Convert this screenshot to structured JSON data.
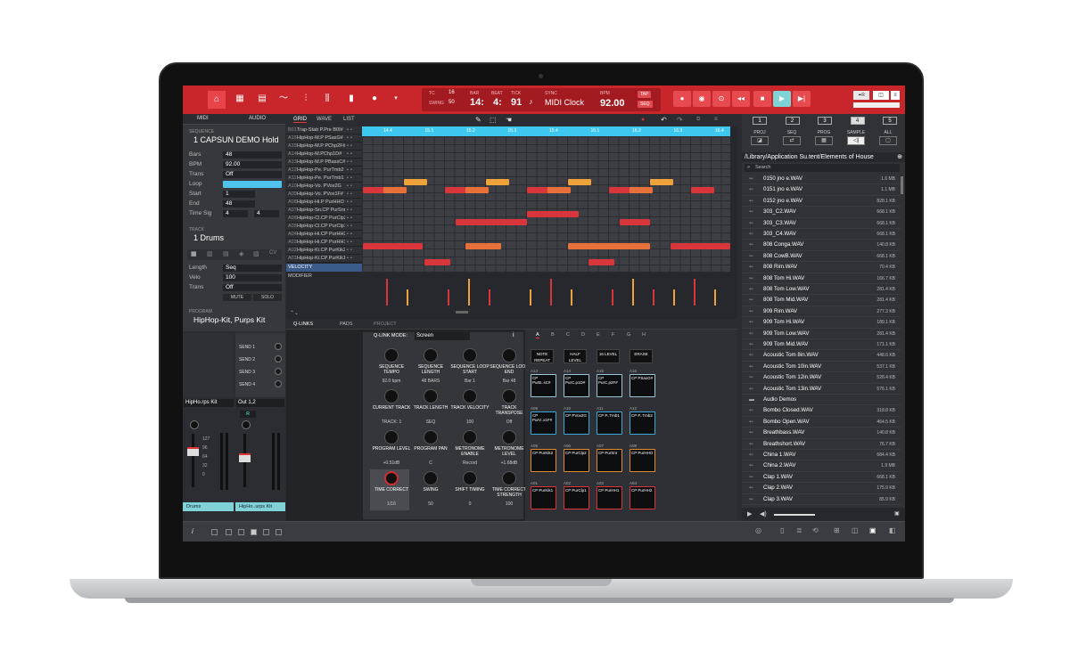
{
  "topbar": {
    "transport": {
      "tc_label": "TC",
      "tc_value": "16",
      "swing_label": "SWING",
      "swing_value": "50",
      "bar_label": "BAR",
      "bar_value": "14:",
      "beat_label": "BEAT",
      "beat_value": "4:",
      "tick_label": "TICK",
      "tick_value": "91",
      "sync_label": "SYNC",
      "sync_value": "MIDI Clock",
      "bpm_label": "BPM",
      "bpm_value": "92.00",
      "tap_label": "TAP",
      "seq_label": "SEQ"
    }
  },
  "left": {
    "tab_midi": "MIDI",
    "tab_audio": "AUDIO",
    "sequence_label": "SEQUENCE",
    "sequence_name": "1 CAPSUN DEMO Hold",
    "fields": {
      "bars_label": "Bars",
      "bars": "48",
      "bpm_label": "BPM",
      "bpm": "92.00",
      "trans_label": "Trans",
      "trans": "Off",
      "loop_label": "Loop",
      "start_label": "Start",
      "start": "1",
      "end_label": "End",
      "end": "48",
      "timesig_label": "Time Sig",
      "ts_num": "4",
      "ts_den": "4"
    },
    "track_label": "TRACK",
    "track_name": "1 Drums",
    "track_fields": {
      "length_label": "Length",
      "length": "Seq",
      "velo_label": "Velo",
      "velo": "100",
      "trans_label": "Trans",
      "trans": "Off",
      "mute": "MUTE",
      "solo": "SOLO",
      "cv": "CV"
    },
    "program_label": "PROGRAM",
    "program_name": "HipHop-Kit, Purps Kit",
    "mixer": {
      "sends": [
        "SEND 1",
        "SEND 2",
        "SEND 3",
        "SEND 4"
      ],
      "input": "HipHo.rps Kit",
      "output": "Out 1,2",
      "rec": "R",
      "ch1": "Drums",
      "ch2": "HipHo..urps Kit",
      "scale": [
        "127",
        "96",
        "64",
        "32",
        "0"
      ]
    }
  },
  "grid": {
    "tabs": [
      "GRID",
      "WAVE",
      "LIST"
    ],
    "ruler": [
      "14.4",
      "15.1",
      "15.2",
      "15.3",
      "15.4",
      "16.1",
      "16.2",
      "16.3",
      "16.4"
    ],
    "tracks": [
      {
        "id": "B01",
        "name": "Trap-Stab P.Pre B0I#"
      },
      {
        "id": "A16",
        "name": "HipHop-M.P PSaxG#"
      },
      {
        "id": "A15",
        "name": "HipHop-M.P PChp2F#"
      },
      {
        "id": "A14",
        "name": "HipHop-M.PChp1D#"
      },
      {
        "id": "A13",
        "name": "HipHop-M.P PBassC#"
      },
      {
        "id": "A12",
        "name": "HipHop-Pe. PurTmb2"
      },
      {
        "id": "A11",
        "name": "HipHop-Pe. PurTmb1"
      },
      {
        "id": "A10",
        "name": "HipHop-Vo. PVox2G"
      },
      {
        "id": "A09",
        "name": "HipHop-Vo. PVox1F#"
      },
      {
        "id": "A08",
        "name": "HipHop-Hi.P PurHHO"
      },
      {
        "id": "A07",
        "name": "HipHop-Sn.CP PurSnr"
      },
      {
        "id": "A06",
        "name": "HipHop-Cl.CP PurClp2"
      },
      {
        "id": "A05",
        "name": "HipHop-Cl.CP PurClp1"
      },
      {
        "id": "A04",
        "name": "HipHop-Hi.CP PurHH2"
      },
      {
        "id": "A03",
        "name": "HipHop-Hi.CP PurHH1"
      },
      {
        "id": "A02",
        "name": "HipHop-Ki.CP PurKik2"
      },
      {
        "id": "A01",
        "name": "HipHop-Ki.CP PurKik1"
      }
    ],
    "velocity_label": "VELOCITY",
    "modifier_label": "MODIFIER"
  },
  "qlinks": {
    "tabs": [
      "Q-LINKS",
      "PADS",
      "PROJECT"
    ],
    "mode_label": "Q-LINK MODE:",
    "mode_value": "Screen",
    "knobs": [
      {
        "label": "SEQUENCE TEMPO",
        "value": "92.0 bpm"
      },
      {
        "label": "SEQUENCE LENGTH",
        "value": "48 BARS"
      },
      {
        "label": "SEQUENCE LOOP START",
        "value": "Bar 1"
      },
      {
        "label": "SEQUENCE LOOP END",
        "value": "Bar 48"
      },
      {
        "label": "CURRENT TRACK",
        "value": "TRACK: 1"
      },
      {
        "label": "TRACK LENGTH",
        "value": "SEQ"
      },
      {
        "label": "TRACK VELOCITY",
        "value": "100"
      },
      {
        "label": "TRACK TRANSPOSE",
        "value": "Off"
      },
      {
        "label": "PROGRAM LEVEL",
        "value": "+0.51dB"
      },
      {
        "label": "PROGRAM PAN",
        "value": "C"
      },
      {
        "label": "METRONOME ENABLE",
        "value": "Record"
      },
      {
        "label": "METRONOME LEVEL",
        "value": "+1.68dB"
      },
      {
        "label": "TIME CORRECT",
        "value": "1/16"
      },
      {
        "label": "SWING",
        "value": "50"
      },
      {
        "label": "SHIFT TIMING",
        "value": "0"
      },
      {
        "label": "TIME CORRECT STRENGTH",
        "value": "100"
      }
    ]
  },
  "pads": {
    "banks": [
      "A",
      "B",
      "C",
      "D",
      "E",
      "F",
      "G",
      "H"
    ],
    "buttons": [
      "NOTE REPEAT",
      "HALF LEVEL",
      "16 LEVEL",
      "ERASE"
    ],
    "grid": [
      {
        "num": "A13",
        "name": "CP PurB..sC#",
        "color": "#9bc7d6"
      },
      {
        "num": "A14",
        "name": "CP PurC.p1D#",
        "color": "#9bc7d6"
      },
      {
        "num": "A15",
        "name": "CP PurC.p2F#",
        "color": "#9bc7d6"
      },
      {
        "num": "A16",
        "name": "CP PSaxG#",
        "color": "#9bc7d6"
      },
      {
        "num": "A09",
        "name": "CP PurV..x1F#",
        "color": "#3aa8d8"
      },
      {
        "num": "A10",
        "name": "CP PVox2G",
        "color": "#3aa8d8"
      },
      {
        "num": "A11",
        "name": "CP P..Tmb1",
        "color": "#3aa8d8"
      },
      {
        "num": "A12",
        "name": "CP P..Tmb2",
        "color": "#3aa8d8"
      },
      {
        "num": "A05",
        "name": "CP PurKik2",
        "color": "#e08b2e"
      },
      {
        "num": "A06",
        "name": "CP PurClp2",
        "color": "#e08b2e"
      },
      {
        "num": "A07",
        "name": "CP PurSnr",
        "color": "#e08b2e"
      },
      {
        "num": "A08",
        "name": "CP PurHHO",
        "color": "#e08b2e"
      },
      {
        "num": "A01",
        "name": "CP PurKik1",
        "color": "#d9363c"
      },
      {
        "num": "A02",
        "name": "CP PurClp1",
        "color": "#d9363c"
      },
      {
        "num": "A03",
        "name": "CP PurHH1",
        "color": "#d9363c"
      },
      {
        "num": "A04",
        "name": "CP PurHH2",
        "color": "#d9363c"
      }
    ]
  },
  "browser": {
    "numbers": [
      "1",
      "2",
      "3",
      "4",
      "5"
    ],
    "categories": [
      "PROJ",
      "SEQ",
      "PROG",
      "SAMPLE",
      "ALL"
    ],
    "path": "/Library/Application Su.tent/Elements of House",
    "search_placeholder": "Search",
    "files": [
      {
        "name": "0150 jno e.WAV",
        "size": "1.6 MB"
      },
      {
        "name": "0151 jno e.WAV",
        "size": "1.1 MB"
      },
      {
        "name": "0152 jno e.WAV",
        "size": "828.1 KB"
      },
      {
        "name": "303_C2.WAV",
        "size": "668.1 KB"
      },
      {
        "name": "303_C3.WAV",
        "size": "668.1 KB"
      },
      {
        "name": "303_C4.WAV",
        "size": "668.1 KB"
      },
      {
        "name": "808 Conga.WAV",
        "size": "140.8 KB"
      },
      {
        "name": "808 CowB.WAV",
        "size": "668.1 KB"
      },
      {
        "name": "808 Rim.WAV",
        "size": "70.4 KB"
      },
      {
        "name": "808 Tom Hi.WAV",
        "size": "166.7 KB"
      },
      {
        "name": "808 Tom Low.WAV",
        "size": "281.4 KB"
      },
      {
        "name": "808 Tom Mid.WAV",
        "size": "281.4 KB"
      },
      {
        "name": "909 Rim.WAV",
        "size": "277.3 KB"
      },
      {
        "name": "909 Tom Hi.WAV",
        "size": "189.1 KB"
      },
      {
        "name": "909 Tom Low.WAV",
        "size": "281.4 KB"
      },
      {
        "name": "909 Tom Mid.WAV",
        "size": "171.1 KB"
      },
      {
        "name": "Acoustic Tom 8in.WAV",
        "size": "448.6 KB"
      },
      {
        "name": "Acoustic Tom 10in.WAV",
        "size": "537.1 KB"
      },
      {
        "name": "Acoustic Tom 12in.WAV",
        "size": "528.4 KB"
      },
      {
        "name": "Acoustic Tom 13in.WAV",
        "size": "576.1 KB"
      },
      {
        "name": "Audio Demos",
        "size": ""
      },
      {
        "name": "Bombo Closed.WAV",
        "size": "318.8 KB"
      },
      {
        "name": "Bombo Open.WAV",
        "size": "464.5 KB"
      },
      {
        "name": "Breathbass.WAV",
        "size": "140.8 KB"
      },
      {
        "name": "Breathshort.WAV",
        "size": "76.7 KB"
      },
      {
        "name": "China 1.WAV",
        "size": "684.4 KB"
      },
      {
        "name": "China 2.WAV",
        "size": "1.9 MB"
      },
      {
        "name": "Clap 1.WAV",
        "size": "668.1 KB"
      },
      {
        "name": "Clap 2.WAV",
        "size": "175.9 KB"
      },
      {
        "name": "Clap 3.WAV",
        "size": "85.9 KB"
      }
    ]
  },
  "colors": {
    "topbar": "#c9262c",
    "accent_blue": "#3ec8ef",
    "note_red": "#d9363c",
    "note_orange": "#e8703a",
    "note_yellow": "#f0a23a"
  }
}
